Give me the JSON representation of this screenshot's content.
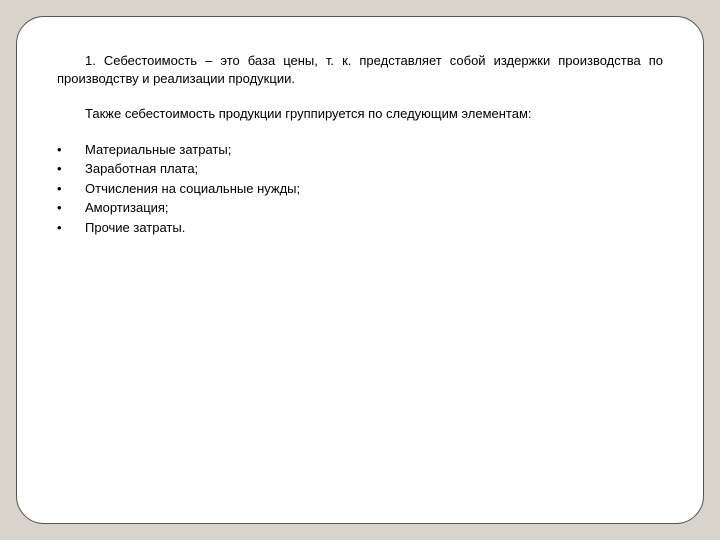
{
  "paragraph1": "1. Себестоимость – это база цены, т. к. представляет собой издержки производства по производству и реализации продукции.",
  "paragraph2": "Также себестоимость продукции группируется по следующим элементам:",
  "bullet": "•",
  "list": {
    "items": [
      {
        "text": "Материальные затраты;"
      },
      {
        "text": "Заработная плата;"
      },
      {
        "text": "Отчисления на социальные нужды;"
      },
      {
        "text": "Амортизация;"
      },
      {
        "text": "Прочие затраты."
      }
    ]
  }
}
